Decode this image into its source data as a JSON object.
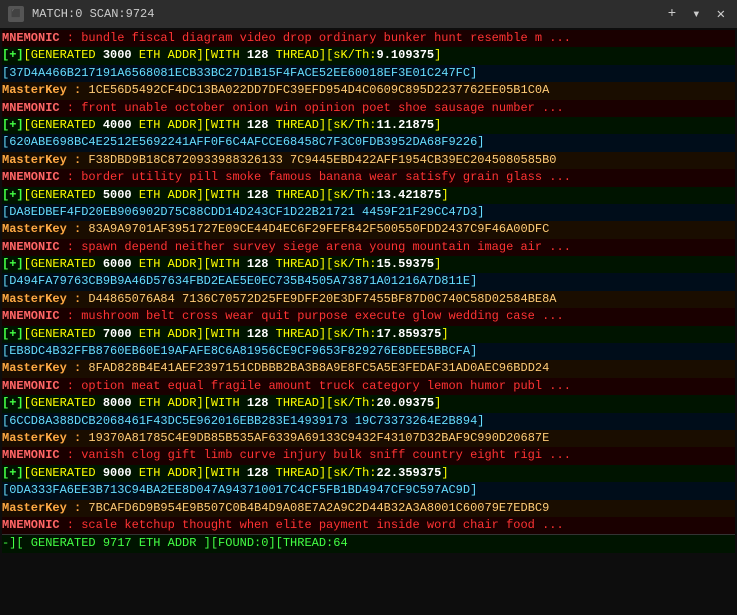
{
  "titleBar": {
    "icon": "⬛",
    "title": "MATCH:0 SCAN:9724",
    "close": "✕",
    "plus": "+",
    "arrow": "▾"
  },
  "lines": [
    {
      "type": "mnemonic",
      "text": "MNEMONIC : bundle fiscal diagram video drop ordinary bunker hunt resemble m ..."
    },
    {
      "type": "generated",
      "prefix": "[+]",
      "gen": "[GENERATED",
      "num": "3000",
      "eth": "ETH ADDR][WITH",
      "threads": "128",
      "thread": "THREAD][sK/Th:",
      "val": "9.109375",
      "end": "]"
    },
    {
      "type": "hex",
      "text": "37D4A466B217191A6568081ECB33BC27D1B15F4FACE52EE60018EF3E01C247FC"
    },
    {
      "type": "masterkey",
      "label": "MasterKey :",
      "val": "1CE56D5492CF4DC13BA022DD7DFC39EFD954D4C0609C895D2237762EE05B1C0A"
    },
    {
      "type": "mnemonic",
      "text": "MNEMONIC : front unable october onion win opinion poet shoe sausage number ..."
    },
    {
      "type": "generated",
      "prefix": "[+]",
      "gen": "[GENERATED",
      "num": "4000",
      "eth": "ETH ADDR][WITH",
      "threads": "128",
      "thread": "THREAD][sK/Th:",
      "val": "11.21875",
      "end": "]"
    },
    {
      "type": "hex",
      "text": "620ABE698BC4E2512E5692241AFF0F6C4AFCCE68458C7F3C0FDB3952DA68F9226"
    },
    {
      "type": "masterkey",
      "label": "MasterKey :",
      "val": "F38DBD9B18C8720933988326133 7C9445EBD422AFF1954CB39EC2045080585B0"
    },
    {
      "type": "mnemonic",
      "text": "MNEMONIC : border utility pill smoke famous banana wear satisfy grain glass ..."
    },
    {
      "type": "generated",
      "prefix": "[+]",
      "gen": "[GENERATED",
      "num": "5000",
      "eth": "ETH ADDR][WITH",
      "threads": "128",
      "thread": "THREAD][sK/Th:",
      "val": "13.421875",
      "end": "]"
    },
    {
      "type": "hex",
      "text": "DA8EDBEF4FD20EB906902D75C88CDD14D243CF1D22B21721 4459F21F29CC47D3"
    },
    {
      "type": "masterkey",
      "label": "MasterKey :",
      "val": "83A9A9701AF3951727E09CE44D4EC6F29FEF842F500550FDD2437C9F46A00DFC"
    },
    {
      "type": "mnemonic",
      "text": "MNEMONIC : spawn depend neither survey siege arena young mountain image air ..."
    },
    {
      "type": "generated",
      "prefix": "[+]",
      "gen": "[GENERATED",
      "num": "6000",
      "eth": "ETH ADDR][WITH",
      "threads": "128",
      "thread": "THREAD][sK/Th:",
      "val": "15.59375",
      "end": "]"
    },
    {
      "type": "hex",
      "text": "D494FA79763CB9B9A46D57634FBD2EAE5E0EC735B4505A73871A01216A7D811E"
    },
    {
      "type": "masterkey",
      "label": "MasterKey :",
      "val": "D44865076A84 7136C70572D25FE9DFF20E3DF7455BF87D0C740C58D02584BE8A"
    },
    {
      "type": "mnemonic",
      "text": "MNEMONIC : mushroom belt cross wear quit purpose execute glow wedding case ..."
    },
    {
      "type": "generated",
      "prefix": "[+]",
      "gen": "[GENERATED",
      "num": "7000",
      "eth": "ETH ADDR][WITH",
      "threads": "128",
      "thread": "THREAD][sK/Th:",
      "val": "17.859375",
      "end": "]"
    },
    {
      "type": "hex",
      "text": "EB8DC4B32FFB8760EB60E19AFAFE8C6A81956CE9CF9653F829276E8DEE5BBCFA"
    },
    {
      "type": "masterkey",
      "label": "MasterKey :",
      "val": "8FAD828B4E41AEF2397151CDBBB2BA3B8A9E8FC5A5E3FEDAF31AD0AEC96BDD24"
    },
    {
      "type": "mnemonic",
      "text": "MNEMONIC : option meat equal fragile amount truck category lemon humor publ ..."
    },
    {
      "type": "generated",
      "prefix": "[+]",
      "gen": "[GENERATED",
      "num": "8000",
      "eth": "ETH ADDR][WITH",
      "threads": "128",
      "thread": "THREAD][sK/Th:",
      "val": "20.09375",
      "end": "]"
    },
    {
      "type": "hex",
      "text": "6CCD8A388DCB2068461F43DC5E962016EBB283E14939173 19C73373264E2B894"
    },
    {
      "type": "masterkey",
      "label": "MasterKey :",
      "val": "19370A81785C4E9DB85B535AF6339A69133C9432F43107D32BAF9C990D20687E"
    },
    {
      "type": "mnemonic",
      "text": "MNEMONIC : vanish clog gift limb curve injury bulk sniff country eight rigi ..."
    },
    {
      "type": "generated",
      "prefix": "[+]",
      "gen": "[GENERATED",
      "num": "9000",
      "eth": "ETH ADDR][WITH",
      "threads": "128",
      "thread": "THREAD][sK/Th:",
      "val": "22.359375",
      "end": "]"
    },
    {
      "type": "hex",
      "text": "0DA333FA6EE3B713C94BA2EE8D047A943710017C4CF5FB1BD4947CF9C597AC9D"
    },
    {
      "type": "masterkey",
      "label": "MasterKey :",
      "val": "7BCAFD6D9B954E9B507C0B4B4D9A08E7A2A9C2D44B32A3A8001C60079E7EDBC9"
    },
    {
      "type": "mnemonic",
      "text": "MNEMONIC : scale ketchup thought when elite payment inside word chair food ..."
    },
    {
      "type": "status",
      "text": "-][ GENERATED 9717 ETH ADDR ][FOUND:0][THREAD:64"
    }
  ],
  "colors": {
    "mnemonic_bg": "#1a0000",
    "mnemonic_fg": "#ff3333",
    "generated_bg": "#001a00",
    "generated_fg": "#33ff33",
    "hex_bg": "#000d1a",
    "hex_fg": "#33ccff",
    "masterkey_bg": "#1a0d00",
    "masterkey_fg": "#ff9900",
    "status_bg": "#001a00",
    "status_fg": "#33ff33"
  }
}
